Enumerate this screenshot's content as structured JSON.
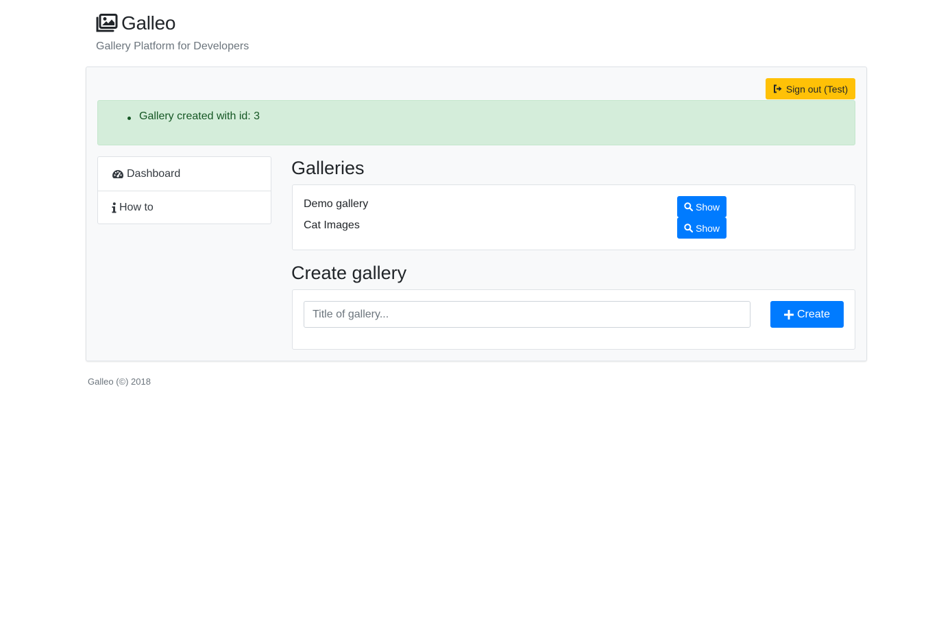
{
  "brand": {
    "title": "Galleo",
    "subtitle": "Gallery Platform for Developers",
    "icon": "images-icon"
  },
  "header": {
    "signout_label": "Sign out (Test)",
    "signout_icon": "sign-out-icon"
  },
  "alert": {
    "messages": [
      "Gallery created with id: 3"
    ]
  },
  "sidebar": {
    "items": [
      {
        "label": "Dashboard",
        "icon": "tachometer-icon"
      },
      {
        "label": "How to",
        "icon": "info-icon"
      }
    ]
  },
  "galleries": {
    "heading": "Galleries",
    "items": [
      {
        "name": "Demo gallery",
        "action_label": "Show"
      },
      {
        "name": "Cat Images",
        "action_label": "Show"
      }
    ]
  },
  "create": {
    "heading": "Create gallery",
    "input_placeholder": "Title of gallery...",
    "input_value": "",
    "button_label": "Create"
  },
  "footer": {
    "text": "Galleo (©) 2018"
  },
  "colors": {
    "primary": "#007bff",
    "warning": "#ffc107",
    "success_bg": "#d4edda",
    "success_text": "#155724",
    "panel_bg": "#f8f9fa"
  }
}
